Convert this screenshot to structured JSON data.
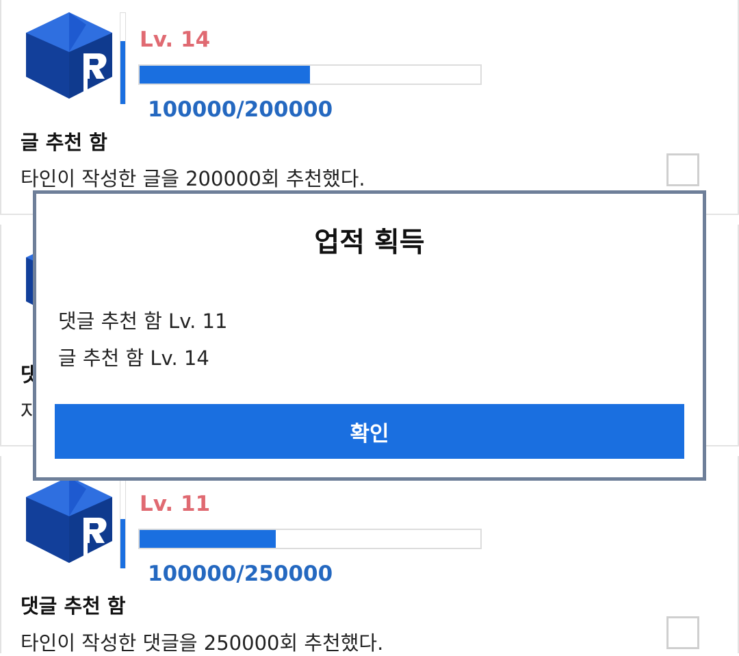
{
  "achievements": [
    {
      "level": "Lv. 14",
      "progress_text": "100000/200000",
      "progress_fraction": 0.5,
      "title": "글 추천 함",
      "description": "타인이 작성한 글을 200000회 추천했다."
    },
    {
      "level": "",
      "progress_text": "",
      "progress_fraction": 0,
      "title": "댓",
      "description": "자"
    },
    {
      "level": "Lv. 11",
      "progress_text": "100000/250000",
      "progress_fraction": 0.4,
      "title": "댓글 추천 함",
      "description": "타인이 작성한 댓글을 250000회 추천했다."
    }
  ],
  "badge_icon": "cube-r-badge-icon",
  "colors": {
    "accent": "#1a6fe0",
    "level": "#e06a72",
    "progress_text": "#2468c0",
    "modal_border": "#6e7f99"
  },
  "modal": {
    "title": "업적 획득",
    "items": [
      "댓글 추천 함 Lv. 11",
      "글 추천 함 Lv. 14"
    ],
    "confirm_label": "확인"
  }
}
